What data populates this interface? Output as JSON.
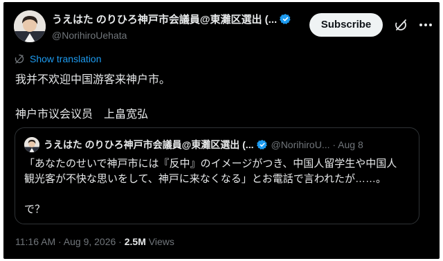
{
  "author": {
    "display_name": "うえはた のりひろ神戸市会議員@東灘区選出 (...",
    "handle": "@NorihiroUehata",
    "verified": true
  },
  "header_actions": {
    "subscribe_label": "Subscribe",
    "grok_icon": "grok-icon",
    "more_icon": "more-icon"
  },
  "translation": {
    "label": "Show translation"
  },
  "tweet": {
    "lines": [
      "我并不欢迎中国游客来神户市。",
      "神户市议会议员　上畠宽弘"
    ]
  },
  "quoted_tweet": {
    "display_name": "うえはた のりひろ神戸市会議員@東灘区選出 (...",
    "handle_time": "@NorihiroU... · Aug 8",
    "verified": true,
    "text_lines": [
      "「あなたのせいで神戸市には『反中』のイメージがつき、中国人留学生や中国人",
      "観光客が不快な思いをして、神戸に来なくなる」とお電話で言われたが……。",
      "で？"
    ]
  },
  "footer": {
    "timestamp": "11:16 AM · Aug 9, 2026 · ",
    "views_count": "2.5M",
    "views_label": " Views"
  },
  "colors": {
    "background": "#000000",
    "text": "#e7e9ea",
    "secondary_text": "#71767b",
    "accent": "#1d9bf0",
    "border": "#2f3336"
  }
}
